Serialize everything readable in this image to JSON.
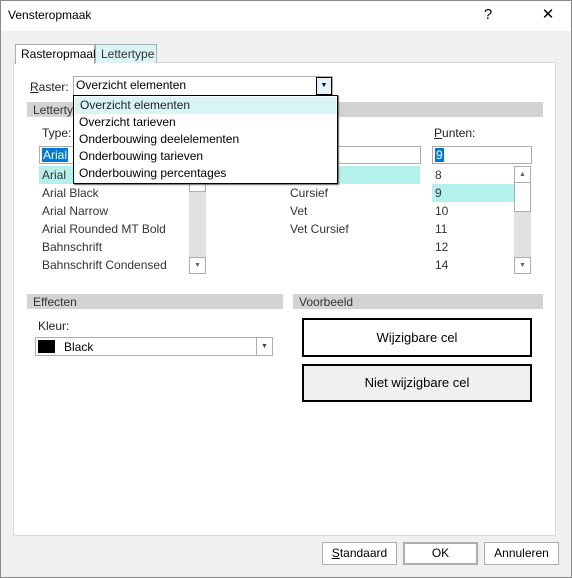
{
  "window": {
    "title": "Vensteropmaak",
    "help": "?",
    "close": "✕"
  },
  "tabs": [
    {
      "label": "Rasteropmaak",
      "active": true
    },
    {
      "label": "Lettertype",
      "active": false
    }
  ],
  "raster": {
    "label": "Raster:",
    "value": "Overzicht elementen",
    "options": [
      "Overzicht elementen",
      "Overzicht tarieven",
      "Onderbouwing deelelementen",
      "Onderbouwing tarieven",
      "Onderbouwing percentages"
    ]
  },
  "lettertype": {
    "section": "Lettertype",
    "type": {
      "label": "Type:",
      "value": "Arial",
      "items": [
        "Arial",
        "Arial Black",
        "Arial Narrow",
        "Arial Rounded MT Bold",
        "Bahnschrift",
        "Bahnschrift Condensed"
      ]
    },
    "style": {
      "items": [
        "Cursief",
        "Vet",
        "Vet Cursief"
      ]
    },
    "punten": {
      "label": "Punten:",
      "value": "9",
      "items": [
        "8",
        "9",
        "10",
        "11",
        "12",
        "14"
      ]
    }
  },
  "effecten": {
    "section": "Effecten",
    "kleur_label": "Kleur:",
    "kleur_value": "Black",
    "swatch": "#000000"
  },
  "voorbeeld": {
    "section": "Voorbeeld",
    "editable": "Wijzigbare cel",
    "noneditable": "Niet wijzigbare cel"
  },
  "buttons": {
    "standaard": "Standaard",
    "ok": "OK",
    "annuleren": "Annuleren"
  },
  "colors": {
    "highlight": "#b5f1ec",
    "selection": "#0078d7"
  }
}
